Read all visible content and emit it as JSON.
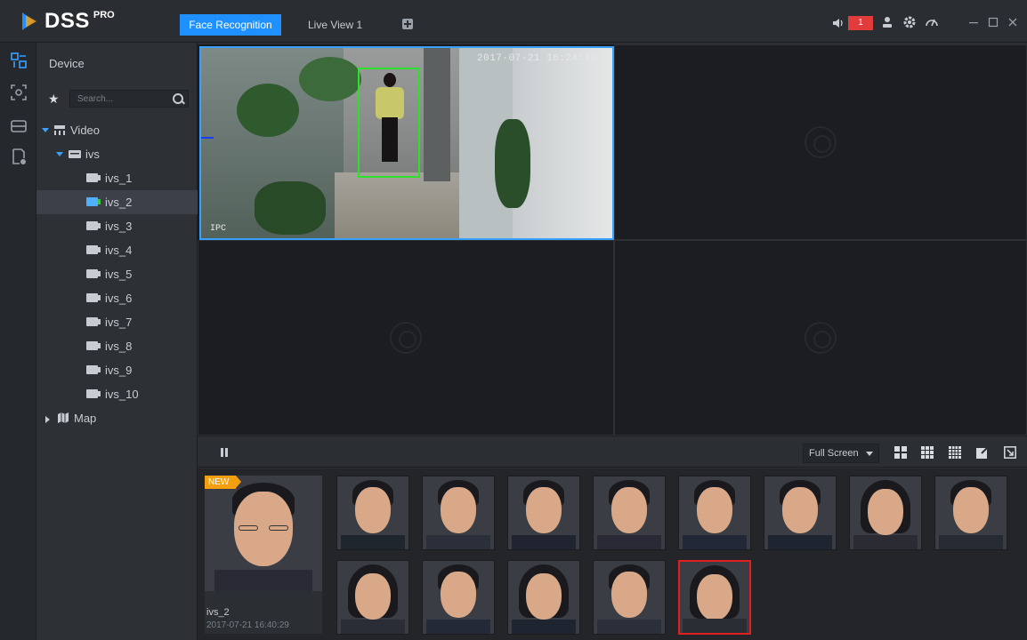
{
  "app": {
    "brand": "DSS",
    "edition": "PRO"
  },
  "tabs": [
    {
      "label": "Face Recognition",
      "active": true
    },
    {
      "label": "Live View 1",
      "active": false
    }
  ],
  "header": {
    "alarm_count": "1",
    "icons": [
      "speaker-icon",
      "user-icon",
      "gear-icon",
      "speedometer-icon",
      "minimize-icon",
      "maximize-icon",
      "close-icon"
    ]
  },
  "colors": {
    "accent": "#1e90ff",
    "alarm": "#e23b3b",
    "new_badge": "#f4a00e",
    "detect_box": "#2ce02c",
    "selected_capture": "#e02020"
  },
  "rail": [
    "live-view-icon",
    "face-search-icon",
    "device-icon",
    "report-icon"
  ],
  "tree": {
    "title": "Device",
    "search_placeholder": "Search...",
    "root": "Video",
    "group": "ivs",
    "channels": [
      "ivs_1",
      "ivs_2",
      "ivs_3",
      "ivs_4",
      "ivs_5",
      "ivs_6",
      "ivs_7",
      "ivs_8",
      "ivs_9",
      "ivs_10"
    ],
    "selected": "ivs_2",
    "map": "Map"
  },
  "video": {
    "timestamp": "2017-07-21 16:24:40",
    "camera_label": "IPC"
  },
  "toolbar": {
    "view_mode": "Full Screen"
  },
  "captures": {
    "new_label": "NEW",
    "latest_channel": "ivs_2",
    "latest_time": "2017-07-21 16:40:29"
  }
}
